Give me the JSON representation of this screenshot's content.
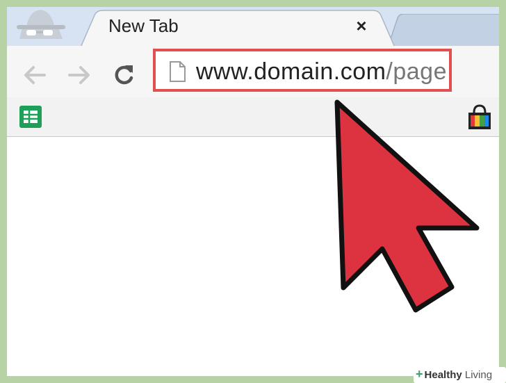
{
  "browser": {
    "tab": {
      "title": "New Tab",
      "close_glyph": "×"
    },
    "omnibox": {
      "domain": "www.domain.com",
      "path": "/page"
    },
    "icons": {
      "incognito": "incognito-icon",
      "back": "back-arrow-icon",
      "forward": "forward-arrow-icon",
      "reload": "reload-icon",
      "page": "page-icon",
      "sheets": "google-sheets-icon",
      "store": "web-store-icon"
    },
    "highlight_color": "#e24f4f"
  },
  "annotation": {
    "cursor_color": "#dd3340"
  },
  "watermark": {
    "plus": "+",
    "bold": "Healthy",
    "light": " Living"
  }
}
